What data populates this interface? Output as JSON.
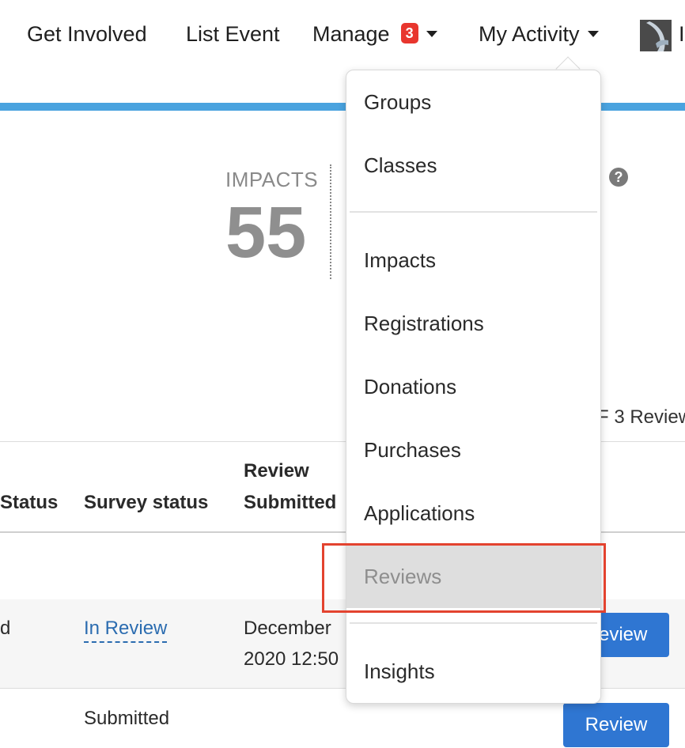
{
  "nav": {
    "items": [
      {
        "label": "Get Involved"
      },
      {
        "label": "List Event"
      },
      {
        "label": "Manage",
        "badge": "3"
      },
      {
        "label": "My Activity"
      }
    ],
    "avatar_edge_text": "I"
  },
  "stats": {
    "impacts_label": "IMPACTS",
    "impacts_value": "55",
    "help_glyph": "?",
    "reviews_count": "F 3 Review"
  },
  "table": {
    "headers": {
      "status": "Status",
      "survey_status": "Survey status",
      "review_submitted_line1": "Review",
      "review_submitted_line2": "Submitted"
    },
    "rows": [
      {
        "status_fragment": "d",
        "survey_status": "In Review",
        "submitted_line1": "December",
        "submitted_line2": "2020 12:50",
        "action": "Review"
      },
      {
        "survey_status": "Submitted",
        "action": "Review"
      }
    ]
  },
  "dropdown": {
    "items": [
      "Groups",
      "Classes",
      "Impacts",
      "Registrations",
      "Donations",
      "Purchases",
      "Applications",
      "Reviews",
      "Insights"
    ],
    "active_item": "Reviews"
  },
  "colors": {
    "accent_blue": "#4aa3df",
    "button_blue": "#2f76d2",
    "badge_red": "#e8362e",
    "highlight_red": "#e3432f"
  }
}
